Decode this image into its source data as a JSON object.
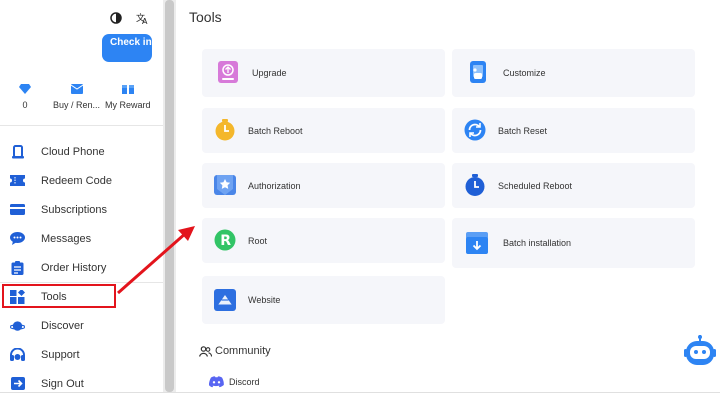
{
  "header": {
    "theme_icon": "contrast-icon",
    "translate_icon": "translate-icon",
    "checkin_label": "Check in"
  },
  "stats": [
    {
      "icon": "diamond-icon",
      "label": "0"
    },
    {
      "icon": "mail-icon",
      "label": "Buy / Ren..."
    },
    {
      "icon": "gift-icon",
      "label": "My Reward"
    }
  ],
  "sidebar": {
    "items": [
      {
        "label": "Cloud Phone",
        "icon": "phone-icon"
      },
      {
        "label": "Redeem Code",
        "icon": "ticket-icon"
      },
      {
        "label": "Subscriptions",
        "icon": "card-icon"
      },
      {
        "label": "Messages",
        "icon": "chat-icon"
      },
      {
        "label": "Order History",
        "icon": "clipboard-icon"
      },
      {
        "label": "Tools",
        "icon": "tools-icon"
      },
      {
        "label": "Discover",
        "icon": "planet-icon"
      },
      {
        "label": "Support",
        "icon": "support-icon"
      },
      {
        "label": "Sign Out",
        "icon": "signout-icon"
      }
    ]
  },
  "main": {
    "title": "Tools",
    "tools": [
      {
        "label": "Upgrade",
        "icon": "upgrade-icon"
      },
      {
        "label": "Customize",
        "icon": "customize-icon"
      },
      {
        "label": "Batch Reboot",
        "icon": "timer-icon"
      },
      {
        "label": "Batch Reset",
        "icon": "reset-icon"
      },
      {
        "label": "Authorization",
        "icon": "authorization-icon"
      },
      {
        "label": "Scheduled Reboot",
        "icon": "stopwatch-icon"
      },
      {
        "label": "Root",
        "icon": "root-icon"
      },
      {
        "label": "Batch installation",
        "icon": "install-icon"
      },
      {
        "label": "Website",
        "icon": "website-icon"
      }
    ],
    "community_label": "Community",
    "discord_label": "Discord"
  },
  "colors": {
    "accent": "#2d84f3",
    "highlight": "#e3141c",
    "card_bg": "#f5f6fa"
  }
}
